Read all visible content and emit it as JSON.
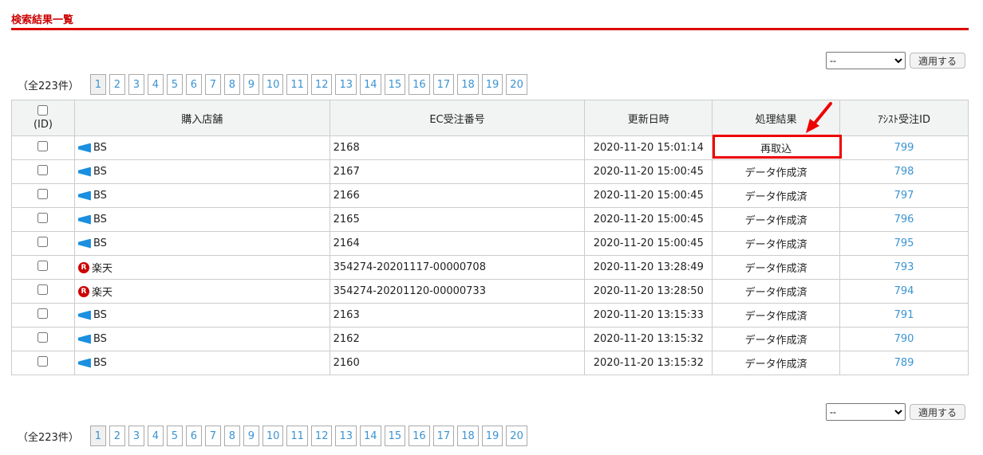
{
  "title": "検索結果一覧",
  "bulk": {
    "select_value": "--",
    "apply_label": "適用する"
  },
  "pager": {
    "count": "（全223件）",
    "pages": [
      "1",
      "2",
      "3",
      "4",
      "5",
      "6",
      "7",
      "8",
      "9",
      "10",
      "11",
      "12",
      "13",
      "14",
      "15",
      "16",
      "17",
      "18",
      "19",
      "20"
    ],
    "current": "1"
  },
  "table": {
    "headers": {
      "id": "(ID)",
      "shop": "購入店舗",
      "ec_order": "EC受注番号",
      "updated": "更新日時",
      "result": "処理結果",
      "assist_id": "ｱｼｽﾄ受注ID"
    },
    "rows": [
      {
        "shop": "BS",
        "shop_icon": "bs-icon",
        "ec_order": "2168",
        "updated": "2020-11-20 15:01:14",
        "result": "再取込",
        "assist_id": "799"
      },
      {
        "shop": "BS",
        "shop_icon": "bs-icon",
        "ec_order": "2167",
        "updated": "2020-11-20 15:00:45",
        "result": "データ作成済",
        "assist_id": "798"
      },
      {
        "shop": "BS",
        "shop_icon": "bs-icon",
        "ec_order": "2166",
        "updated": "2020-11-20 15:00:45",
        "result": "データ作成済",
        "assist_id": "797"
      },
      {
        "shop": "BS",
        "shop_icon": "bs-icon",
        "ec_order": "2165",
        "updated": "2020-11-20 15:00:45",
        "result": "データ作成済",
        "assist_id": "796"
      },
      {
        "shop": "BS",
        "shop_icon": "bs-icon",
        "ec_order": "2164",
        "updated": "2020-11-20 15:00:45",
        "result": "データ作成済",
        "assist_id": "795"
      },
      {
        "shop": "楽天",
        "shop_icon": "rakuten-icon",
        "ec_order": "354274-20201117-00000708",
        "updated": "2020-11-20 13:28:49",
        "result": "データ作成済",
        "assist_id": "793"
      },
      {
        "shop": "楽天",
        "shop_icon": "rakuten-icon",
        "ec_order": "354274-20201120-00000733",
        "updated": "2020-11-20 13:28:50",
        "result": "データ作成済",
        "assist_id": "794"
      },
      {
        "shop": "BS",
        "shop_icon": "bs-icon",
        "ec_order": "2163",
        "updated": "2020-11-20 13:15:33",
        "result": "データ作成済",
        "assist_id": "791"
      },
      {
        "shop": "BS",
        "shop_icon": "bs-icon",
        "ec_order": "2162",
        "updated": "2020-11-20 13:15:32",
        "result": "データ作成済",
        "assist_id": "790"
      },
      {
        "shop": "BS",
        "shop_icon": "bs-icon",
        "ec_order": "2160",
        "updated": "2020-11-20 13:15:32",
        "result": "データ作成済",
        "assist_id": "789"
      }
    ]
  },
  "rakuten_letter": "R",
  "colors": {
    "accent": "#dd0000",
    "link": "#3a93d2"
  }
}
